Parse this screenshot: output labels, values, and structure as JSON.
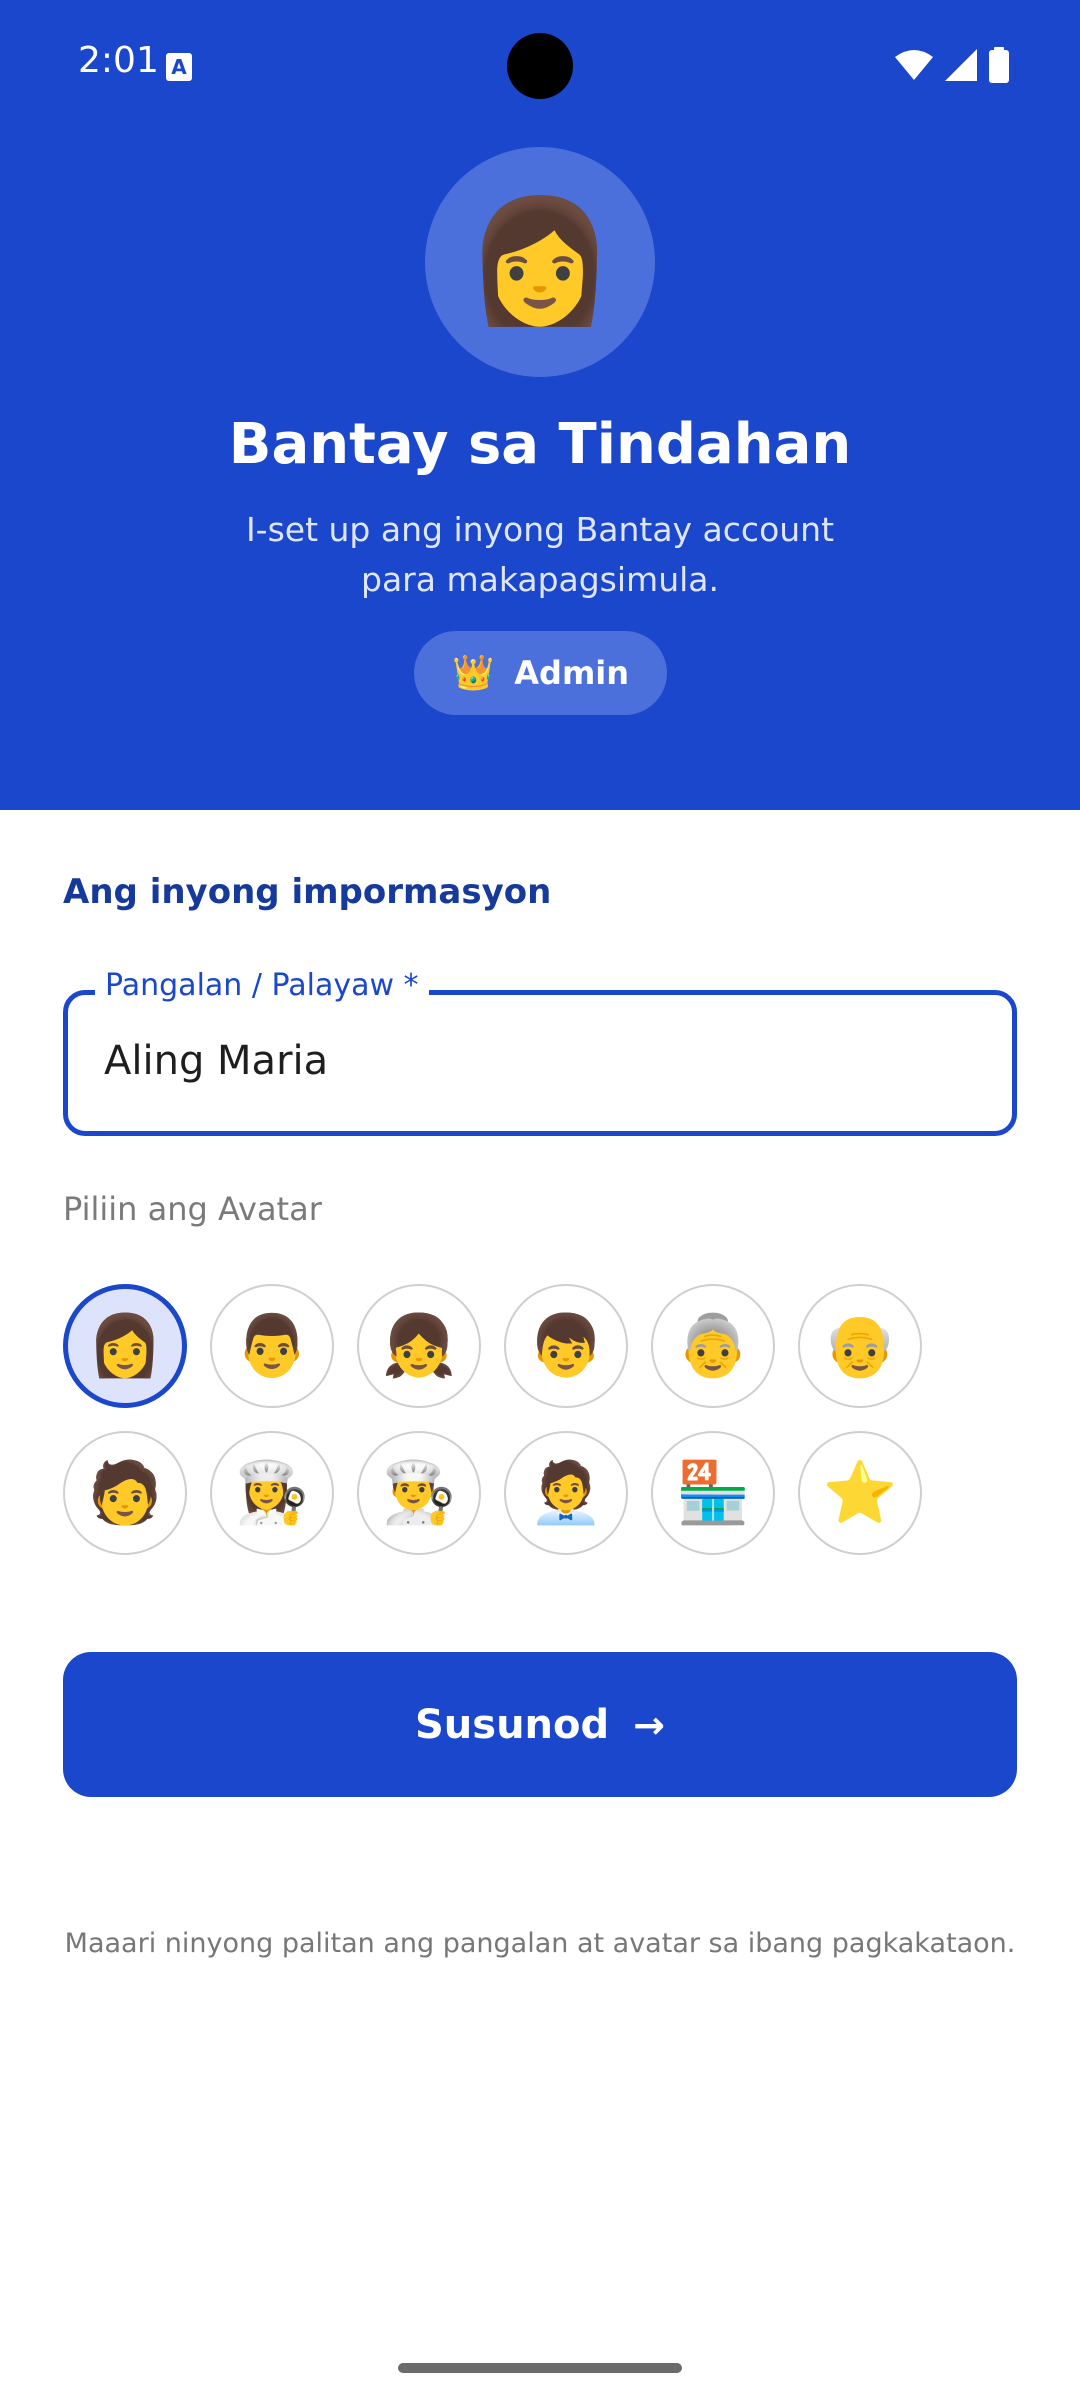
{
  "status_bar": {
    "time": "2:01",
    "notification_icon": "A",
    "icons": [
      "wifi-icon",
      "signal-icon",
      "battery-icon"
    ]
  },
  "header": {
    "avatar_emoji": "👩",
    "title": "Bantay sa Tindahan",
    "subtitle": "I-set up ang inyong Bantay account para makapagsimula.",
    "role_icon": "👑",
    "role_label": "Admin"
  },
  "form": {
    "section_title": "Ang inyong impormasyon",
    "name_field": {
      "label": "Pangalan / Palayaw *",
      "value": "Aling Maria"
    },
    "avatar_label": "Piliin ang Avatar",
    "avatars": [
      {
        "emoji": "👩",
        "selected": true
      },
      {
        "emoji": "👨",
        "selected": false
      },
      {
        "emoji": "👧",
        "selected": false
      },
      {
        "emoji": "👦",
        "selected": false
      },
      {
        "emoji": "👵",
        "selected": false
      },
      {
        "emoji": "👴",
        "selected": false
      },
      {
        "emoji": "🧑",
        "selected": false
      },
      {
        "emoji": "👩‍🍳",
        "selected": false
      },
      {
        "emoji": "👨‍🍳",
        "selected": false
      },
      {
        "emoji": "🧑‍💼",
        "selected": false
      },
      {
        "emoji": "🏪",
        "selected": false
      },
      {
        "emoji": "⭐",
        "selected": false
      }
    ],
    "next_label": "Susunod",
    "next_arrow": "→",
    "footnote": "Maaari ninyong palitan ang pangalan at avatar sa ibang pagkakataon."
  },
  "colors": {
    "primary": "#1a47cc",
    "primary_light": "#4b6fdb",
    "section_title": "#163a9c",
    "selected_avatar_bg": "#dde3fa"
  }
}
